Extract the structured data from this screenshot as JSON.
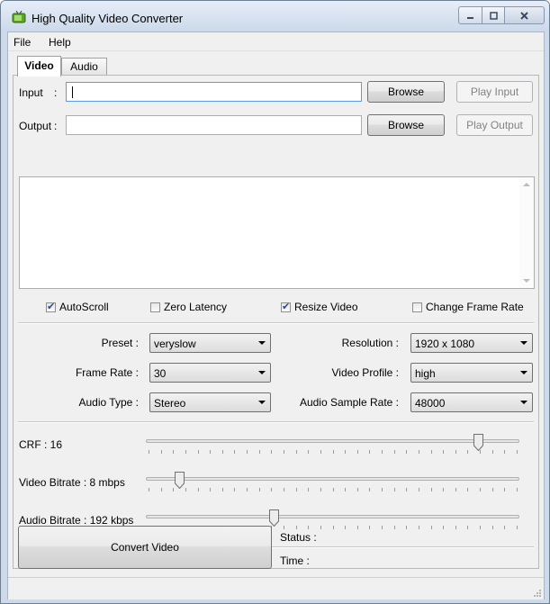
{
  "window": {
    "title": "High Quality Video Converter"
  },
  "caption": {
    "minimize": "minimize-icon",
    "maximize": "maximize-icon",
    "close": "close-icon"
  },
  "menu": {
    "file": "File",
    "help": "Help"
  },
  "tabs": [
    {
      "label": "Video"
    },
    {
      "label": "Audio"
    }
  ],
  "input": {
    "label": "Input",
    "sep": ":",
    "value": "",
    "browse": "Browse",
    "play": "Play Input"
  },
  "output": {
    "label": "Output",
    "sep": ":",
    "value": "",
    "browse": "Browse",
    "play": "Play Output"
  },
  "log": {
    "text": ""
  },
  "options": [
    {
      "label": "AutoScroll",
      "checked": true
    },
    {
      "label": "Zero Latency",
      "checked": false
    },
    {
      "label": "Resize Video",
      "checked": true
    },
    {
      "label": "Change Frame Rate",
      "checked": false
    }
  ],
  "settings": {
    "preset": {
      "label": "Preset :",
      "value": "veryslow"
    },
    "resolution": {
      "label": "Resolution :",
      "value": "1920 x 1080"
    },
    "frame_rate": {
      "label": "Frame Rate :",
      "value": "30"
    },
    "video_profile": {
      "label": "Video Profile :",
      "value": "high"
    },
    "audio_type": {
      "label": "Audio Type :",
      "value": "Stereo"
    },
    "audio_sample_rate": {
      "label": "Audio Sample Rate :",
      "value": "48000"
    }
  },
  "sliders": {
    "crf": {
      "label": "CRF : 16",
      "level": 0.9
    },
    "video_bitrate": {
      "label": "Video Bitrate : 8 mbps",
      "level": 0.08
    },
    "audio_bitrate": {
      "label": "Audio Bitrate : 192 kbps",
      "level": 0.34
    }
  },
  "convert": {
    "label": "Convert  Video"
  },
  "status": {
    "status_label": "Status :",
    "time_label": "Time :"
  },
  "colors": {
    "accent": "#569de5",
    "frame": "#cfdae8"
  }
}
